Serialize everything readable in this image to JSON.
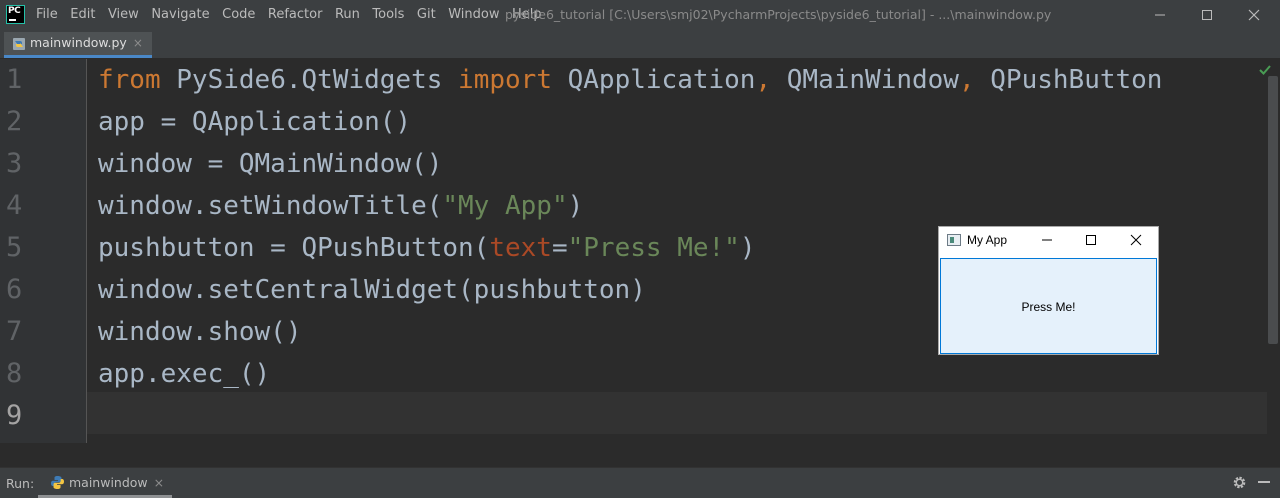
{
  "menu": [
    "File",
    "Edit",
    "View",
    "Navigate",
    "Code",
    "Refactor",
    "Run",
    "Tools",
    "Git",
    "Window",
    "Help"
  ],
  "window_title": "pyside6_tutorial [C:\\Users\\smj02\\PycharmProjects\\pyside6_tutorial] - ...\\mainwindow.py",
  "editor_tab": {
    "label": "mainwindow.py",
    "close": "×"
  },
  "line_numbers": [
    "1",
    "2",
    "3",
    "4",
    "5",
    "6",
    "7",
    "8",
    "9"
  ],
  "code": {
    "l1": {
      "kw1": "from",
      "t1": " PySide6.QtWidgets ",
      "kw2": "import",
      "t2": " QApplication",
      "c1": ",",
      "t3": " QMainWindow",
      "c2": ",",
      "t4": " QPushButton"
    },
    "l2": "app = QApplication()",
    "l3": "window = QMainWindow()",
    "l4": {
      "pre": "window.setWindowTitle(",
      "str": "\"My App\"",
      "post": ")"
    },
    "l5": {
      "pre": "pushbutton = QPushButton(",
      "param": "text",
      "eq": "=",
      "str": "\"Press Me!\"",
      "post": ")"
    },
    "l6": "window.setCentralWidget(pushbutton)",
    "l7": "window.show()",
    "l8": "app.exec_()"
  },
  "run_panel": {
    "label": "Run:",
    "tab": "mainwindow",
    "close": "×"
  },
  "app_window": {
    "title": "My App",
    "button_label": "Press Me!"
  },
  "colors": {
    "keyword": "#cc7832",
    "string": "#6a8759",
    "param": "#aa4926",
    "identifier": "#a9b7c6",
    "selection_border": "#0078d7"
  }
}
